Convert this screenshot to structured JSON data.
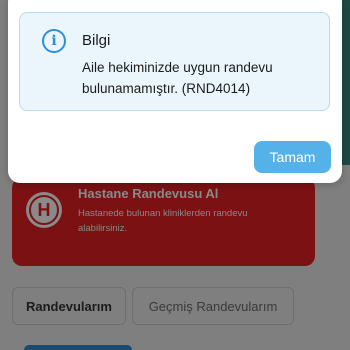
{
  "dialog": {
    "title": "Bilgi",
    "message": "Aile hekiminizde uygun randevu bulunamamıştır. (RND4014)",
    "ok_label": "Tamam",
    "icon": "info-icon"
  },
  "hospital_card": {
    "title": "Hastane Randevusu Al",
    "description": "Hastanede bulunan kliniklerden randevu alabilirsiniz.",
    "badge_letter": "H"
  },
  "tabs": [
    {
      "label": "Randevularım",
      "active": true
    },
    {
      "label": "Geçmiş Randevularım",
      "active": false
    }
  ],
  "colors": {
    "accent": "#55b2e8",
    "info_background": "#eaf5fc",
    "card_red": "#7b1113"
  }
}
